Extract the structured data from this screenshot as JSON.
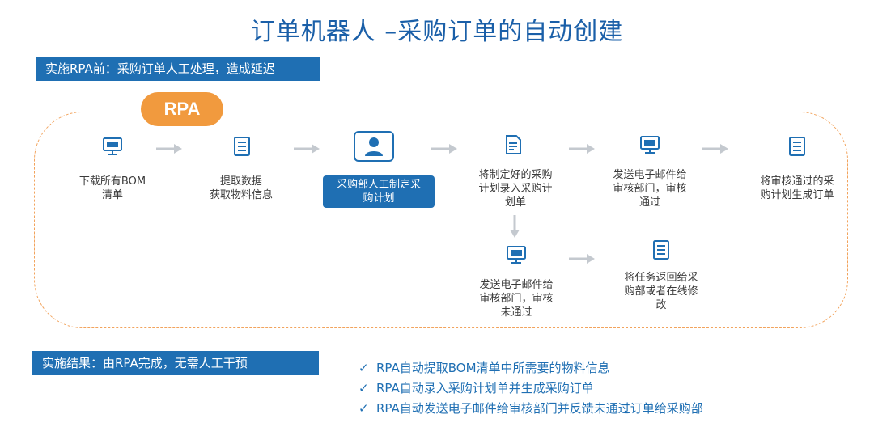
{
  "title": "订单机器人 –采购订单的自动创建",
  "banner_before": "实施RPA前：采购订单人工处理，造成延迟",
  "rpa_badge": "RPA",
  "steps": [
    {
      "label_lines": [
        "下载所有BOM",
        "清单"
      ],
      "icon": "monitor-icon"
    },
    {
      "label_lines": [
        "提取数据",
        "获取物料信息"
      ],
      "icon": "list-document-icon"
    },
    {
      "label_lines": [
        "采购部人工制定采",
        "购计划"
      ],
      "icon": "user-icon"
    },
    {
      "label_lines": [
        "将制定好的采购",
        "计划录入采购计",
        "划单"
      ],
      "icon": "document-edit-icon"
    },
    {
      "label_lines": [
        "发送电子邮件给",
        "审核部门，审核",
        "通过"
      ],
      "icon": "monitor-icon"
    },
    {
      "label_lines": [
        "将审核通过的采",
        "购计划生成订单"
      ],
      "icon": "list-document-icon"
    }
  ],
  "branch_steps": [
    {
      "label_lines": [
        "发送电子邮件给",
        "审核部门，审核",
        "未通过"
      ],
      "icon": "monitor-icon"
    },
    {
      "label_lines": [
        "将任务返回给采",
        "购部或者在线修",
        "改"
      ],
      "icon": "list-document-icon"
    }
  ],
  "banner_result": "实施结果：由RPA完成，无需人工干预",
  "results": [
    "RPA自动提取BOM清单中所需要的物料信息",
    "RPA自动录入采购计划单并生成采购订单",
    "RPA自动发送电子邮件给审核部门并反馈未通过订单给采购部"
  ],
  "check_symbol": "✓",
  "colors": {
    "primary": "#1f6fb3",
    "title": "#1a5fa8",
    "accent": "#f19a3e",
    "arrow": "#c4c9cf"
  }
}
